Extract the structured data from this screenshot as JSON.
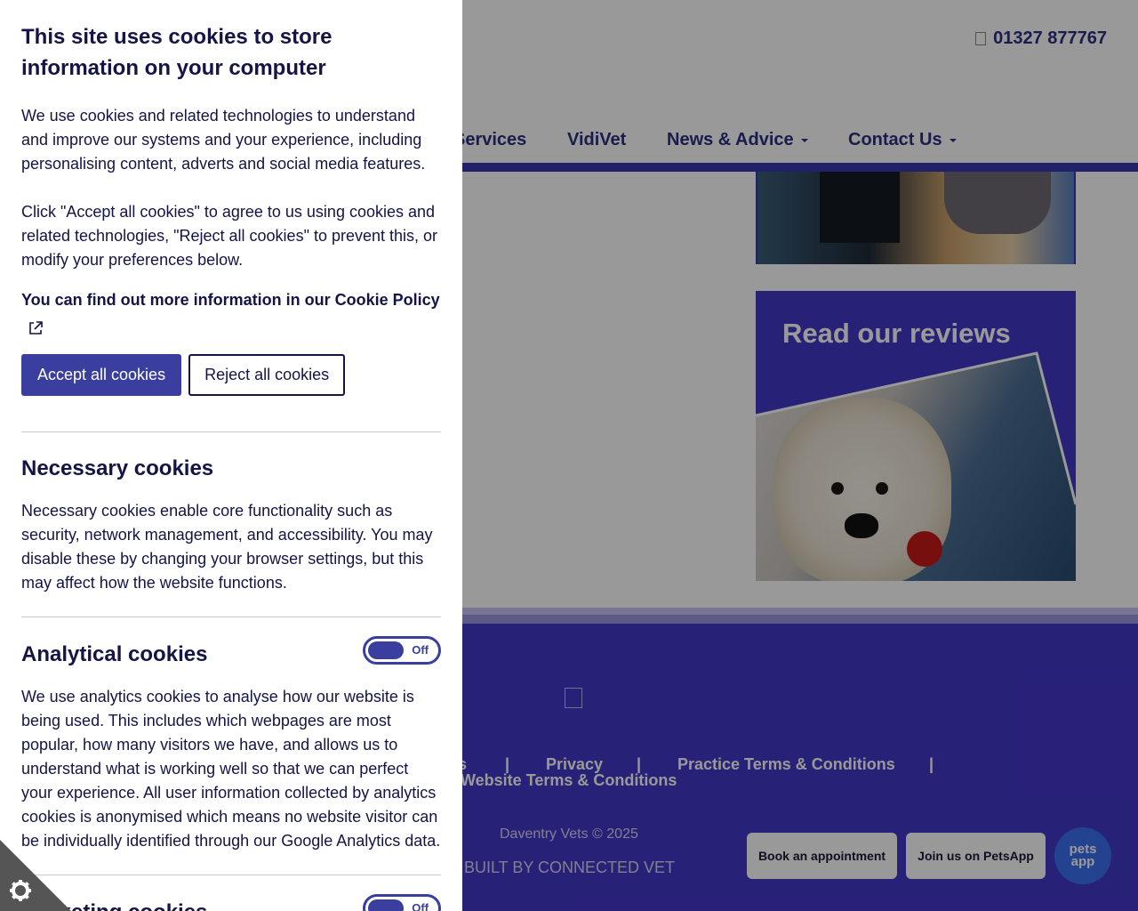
{
  "header": {
    "phone": "01327 877767",
    "nav": [
      {
        "label": "Services",
        "dropdown": false
      },
      {
        "label": "VidiVet",
        "dropdown": false
      },
      {
        "label": "News & Advice",
        "dropdown": true
      },
      {
        "label": "Contact Us",
        "dropdown": true
      }
    ]
  },
  "content": {
    "reviews_title": "Read our reviews"
  },
  "footer": {
    "links": [
      "s",
      "Privacy",
      "Practice Terms & Conditions",
      "Website Terms & Conditions"
    ],
    "separator": "|",
    "copyright": "Daventry Vets © 2025",
    "built_by": "BUILT BY CONNECTED VET",
    "book_button": "Book an appointment",
    "join_button": "Join us on PetsApp",
    "petsapp_logo_top": "pets",
    "petsapp_logo_bottom": "app"
  },
  "cookie_panel": {
    "title": "This site uses cookies to store information on your computer",
    "intro": "We use cookies and related technologies to understand and improve our systems and your experience, including personalising content, adverts and social media features.",
    "intro2": "Click \"Accept all cookies\" to agree to us using cookies and related technologies, \"Reject all cookies\" to prevent this, or modify your preferences below.",
    "policy_prefix": "You can find out more information in our ",
    "policy_link": "Cookie Policy",
    "accept_label": "Accept all cookies",
    "reject_label": "Reject all cookies",
    "sections": [
      {
        "title": "Necessary cookies",
        "text": "Necessary cookies enable core functionality such as security, network management, and accessibility. You may disable these by changing your browser settings, but this may affect how the website functions."
      },
      {
        "title": "Analytical cookies",
        "toggle": "Off",
        "text": "We use analytics cookies to analyse how our website is being used. This includes which webpages are most popular, how many visitors we have, and allows us to understand what is working well so that we can perfect your experience. All user information collected by analytics cookies is anonymised which means no website visitor can be individually identified through our Google Analytics data."
      },
      {
        "title": "Marketing cookies",
        "toggle": "Off"
      }
    ]
  },
  "icons": {
    "cookie_settings": "gear-icon",
    "external_link": "external-link-icon",
    "phone": "phone-icon"
  },
  "colors": {
    "brand_purple": "#4437c9",
    "nav_text": "#2a2f7f",
    "accept_button": "#3a3f9f",
    "petsapp_blue": "#3b6ff1"
  }
}
